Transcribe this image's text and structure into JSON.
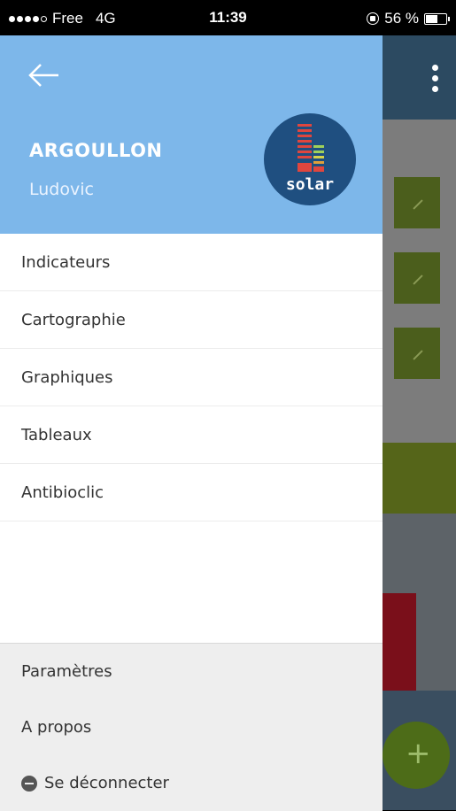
{
  "status_bar": {
    "carrier": "Free",
    "network": "4G",
    "time": "11:39",
    "battery": "56 %",
    "battery_level": 0.56
  },
  "drawer": {
    "last_name": "ARGOULLON",
    "first_name": "Ludovic",
    "logo_text": "solar",
    "menu_items": [
      {
        "label": "Indicateurs"
      },
      {
        "label": "Cartographie"
      },
      {
        "label": "Graphiques"
      },
      {
        "label": "Tableaux"
      },
      {
        "label": "Antibioclic"
      }
    ],
    "footer_items": [
      {
        "label": "Paramètres"
      },
      {
        "label": "A propos"
      },
      {
        "label": "Se déconnecter",
        "icon": "logout-icon"
      }
    ]
  },
  "background_app": {
    "fab_label": "+"
  },
  "colors": {
    "drawer_header": "#7db7ea",
    "app_header": "#2c4a61",
    "accent_green": "#4d6c18"
  }
}
